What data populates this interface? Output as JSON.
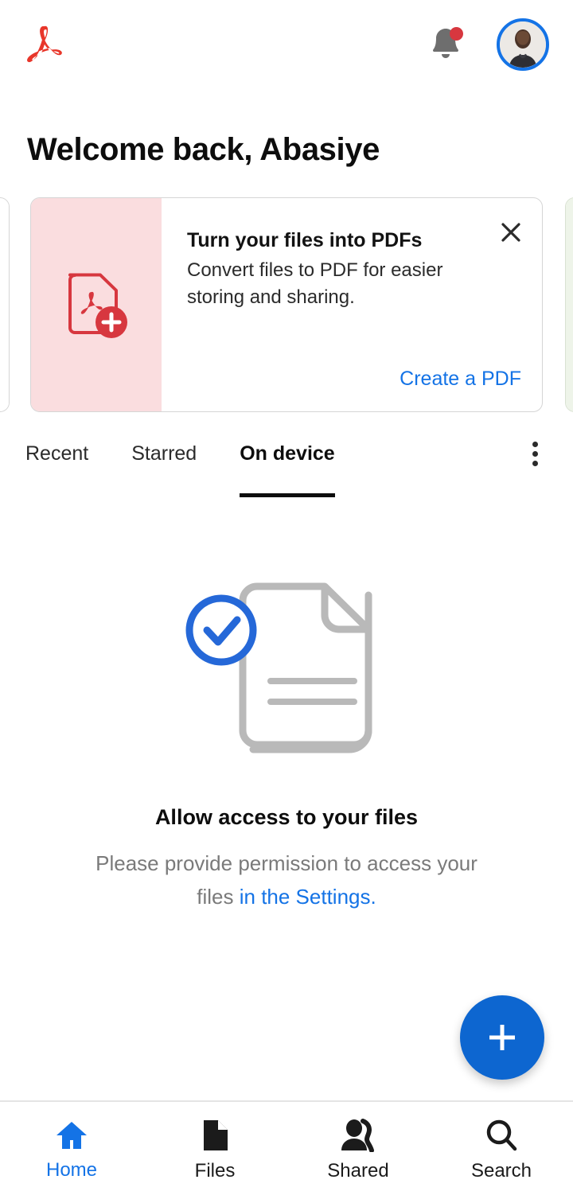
{
  "header": {
    "brand": "adobe-acrobat-logo",
    "notifications_icon": "bell-icon",
    "has_notification_badge": true,
    "avatar_alt": "Abasiye"
  },
  "welcome": {
    "greeting": "Welcome back, Abasiye"
  },
  "promo": {
    "title": "Turn your files into PDFs",
    "description": "Convert files to PDF for easier storing and sharing.",
    "cta_label": "Create a PDF",
    "close_label": "×",
    "icon": "pdf-add-icon",
    "panel_color": "#FADDDF",
    "accent_color": "#D7373F"
  },
  "tabs": {
    "items": [
      {
        "label": "Recent",
        "active": false
      },
      {
        "label": "Starred",
        "active": false
      },
      {
        "label": "On device",
        "active": true
      }
    ],
    "overflow_label": "more-options"
  },
  "empty_state": {
    "illustration": "document-check-illustration",
    "title": "Allow access to your files",
    "text_before_link": "Please provide permission to access your files ",
    "link_text": "in the Settings."
  },
  "fab": {
    "label": "+",
    "name": "create-button",
    "color": "#0D66D0"
  },
  "bottom_nav": {
    "items": [
      {
        "label": "Home",
        "icon": "home-icon",
        "active": true
      },
      {
        "label": "Files",
        "icon": "file-icon",
        "active": false
      },
      {
        "label": "Shared",
        "icon": "people-icon",
        "active": false
      },
      {
        "label": "Search",
        "icon": "search-icon",
        "active": false
      }
    ]
  },
  "colors": {
    "brand_red": "#E8362A",
    "accent_blue": "#1473E6",
    "nav_active_blue": "#1473E6",
    "badge_red": "#D7373F",
    "muted_gray": "#7A7A7A"
  }
}
